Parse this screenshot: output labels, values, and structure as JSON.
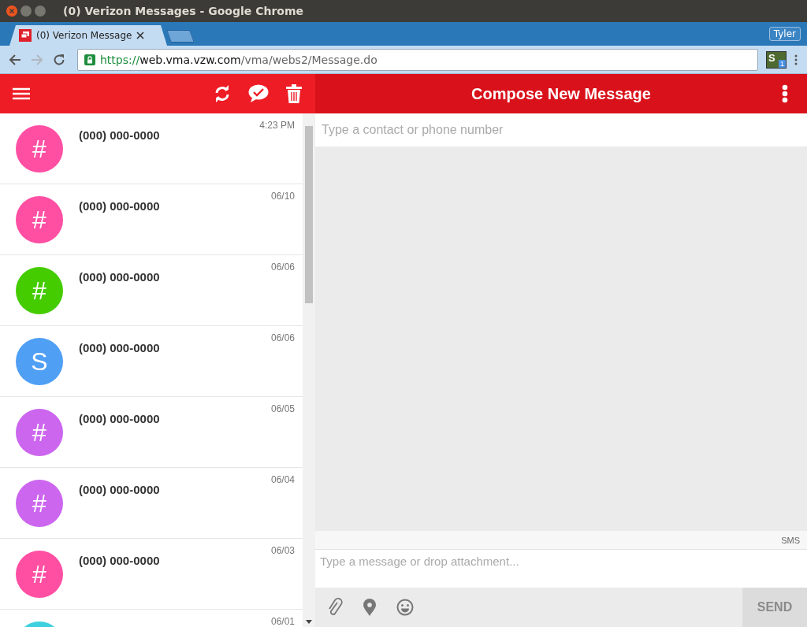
{
  "window": {
    "title": "(0) Verizon Messages - Google Chrome"
  },
  "tabs": [
    {
      "label": "(0) Verizon Message",
      "selected": true
    }
  ],
  "profile": {
    "name": "Tyler"
  },
  "address_bar": {
    "scheme": "https://",
    "host": "web.vma.vzw.com",
    "path": "/vma/webs2/Message.do"
  },
  "extension": {
    "badge": "1",
    "letter": "S"
  },
  "conversations": [
    {
      "avatar": "#",
      "color": "#ff4fa3",
      "name": "(000) 000-0000",
      "time": "4:23 PM"
    },
    {
      "avatar": "#",
      "color": "#ff4fa3",
      "name": "(000) 000-0000",
      "time": "06/10"
    },
    {
      "avatar": "#",
      "color": "#44cc00",
      "name": "(000) 000-0000",
      "time": "06/06"
    },
    {
      "avatar": "S",
      "color": "#4f9ff5",
      "name": "(000) 000-0000",
      "time": "06/06"
    },
    {
      "avatar": "#",
      "color": "#cc66ee",
      "name": "(000) 000-0000",
      "time": "06/05"
    },
    {
      "avatar": "#",
      "color": "#cc66ee",
      "name": "(000) 000-0000",
      "time": "06/04"
    },
    {
      "avatar": "#",
      "color": "#ff4fa3",
      "name": "(000) 000-0000",
      "time": "06/03"
    },
    {
      "color": "#3fd0e0",
      "time": "06/01"
    }
  ],
  "compose": {
    "title": "Compose New Message",
    "to_placeholder": "Type a contact or phone number",
    "mode": "SMS",
    "message_placeholder": "Type a message or drop attachment...",
    "send": {
      "label": "SEND",
      "disabled": true
    }
  }
}
